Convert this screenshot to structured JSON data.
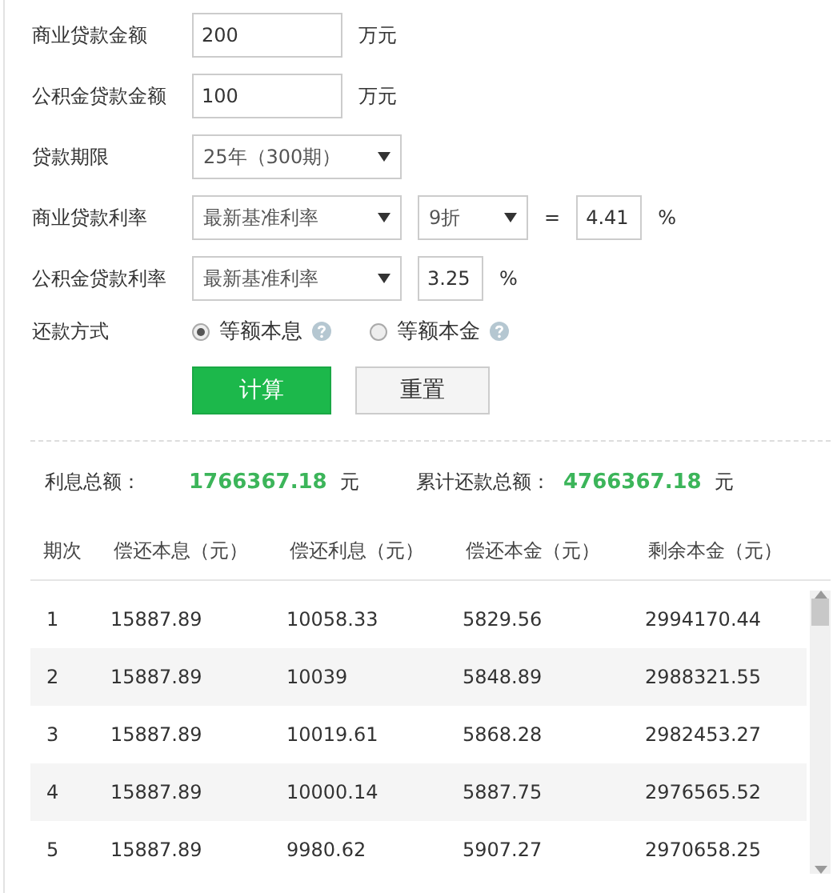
{
  "form": {
    "rows": [
      {
        "label": "商业贷款金额",
        "controls": [
          {
            "kind": "input",
            "value": "200"
          },
          {
            "kind": "text",
            "text": "万元"
          }
        ]
      },
      {
        "label": "公积金贷款金额",
        "controls": [
          {
            "kind": "input",
            "value": "100"
          },
          {
            "kind": "text",
            "text": "万元"
          }
        ]
      },
      {
        "label": "贷款期限",
        "controls": [
          {
            "kind": "select",
            "value": "25年（300期）"
          }
        ]
      },
      {
        "label": "商业贷款利率",
        "controls": [
          {
            "kind": "select",
            "value": "最新基准利率"
          },
          {
            "kind": "select-small",
            "value": "9折"
          },
          {
            "kind": "text",
            "text": "="
          },
          {
            "kind": "input-small",
            "value": "4.41"
          },
          {
            "kind": "text",
            "text": "%"
          }
        ]
      },
      {
        "label": "公积金贷款利率",
        "controls": [
          {
            "kind": "select",
            "value": "最新基准利率"
          },
          {
            "kind": "input-small",
            "value": "3.25"
          },
          {
            "kind": "text",
            "text": "%"
          }
        ]
      },
      {
        "label": "还款方式",
        "controls": [
          {
            "kind": "radio",
            "label": "等额本息",
            "selected": true
          },
          {
            "kind": "radio",
            "label": "等额本金",
            "selected": false
          }
        ]
      }
    ],
    "buttons": [
      {
        "kind": "primary",
        "label": "计算"
      },
      {
        "kind": "secondary",
        "label": "重置"
      }
    ]
  },
  "summary": [
    {
      "label": "利息总额：",
      "value": "1766367.18",
      "unit": "元"
    },
    {
      "label": "累计还款总额：",
      "value": "4766367.18",
      "unit": "元"
    }
  ],
  "table": {
    "columns": [
      "期次",
      "偿还本息（元）",
      "偿还利息（元）",
      "偿还本金（元）",
      "剩余本金（元）"
    ],
    "rows": [
      [
        "1",
        "15887.89",
        "10058.33",
        "5829.56",
        "2994170.44"
      ],
      [
        "2",
        "15887.89",
        "10039",
        "5848.89",
        "2988321.55"
      ],
      [
        "3",
        "15887.89",
        "10019.61",
        "5868.28",
        "2982453.27"
      ],
      [
        "4",
        "15887.89",
        "10000.14",
        "5887.75",
        "2976565.52"
      ],
      [
        "5",
        "15887.89",
        "9980.62",
        "5907.27",
        "2970658.25"
      ]
    ]
  }
}
